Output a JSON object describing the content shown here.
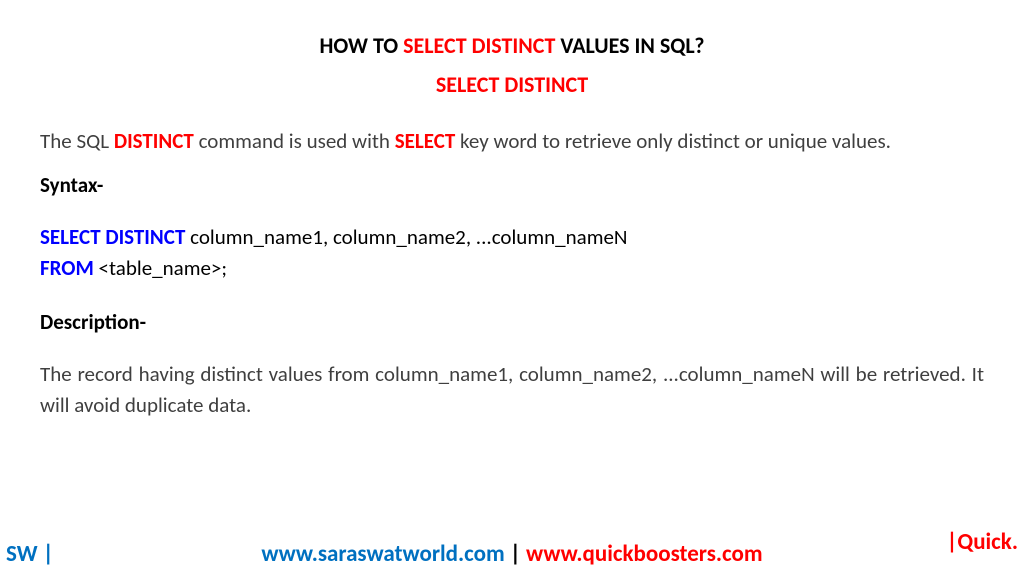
{
  "title": {
    "pre": "HOW TO ",
    "highlight": "SELECT DISTINCT",
    "post": " VALUES IN SQL?"
  },
  "subtitle": "SELECT DISTINCT",
  "intro": {
    "t1": "The SQL ",
    "kw1": "DISTINCT",
    "t2": " command is used with ",
    "kw2": "SELECT",
    "t3": " key word to retrieve only distinct or unique values."
  },
  "syntax_label": "Syntax-",
  "syntax": {
    "kw1": "SELECT DISTINCT",
    "line1_rest": " column_name1, column_name2, ...column_nameN",
    "kw2": "FROM",
    "line2_rest": " <table_name>;"
  },
  "description_label": "Description-",
  "description_text": "The record having distinct values from column_name1, column_name2, ...column_nameN will be retrieved. It will avoid duplicate data.",
  "footer": {
    "left": "SW |",
    "url1": "www.saraswatworld.com",
    "sep": " | ",
    "url2": "www.quickboosters.com",
    "right": "|Quick."
  }
}
